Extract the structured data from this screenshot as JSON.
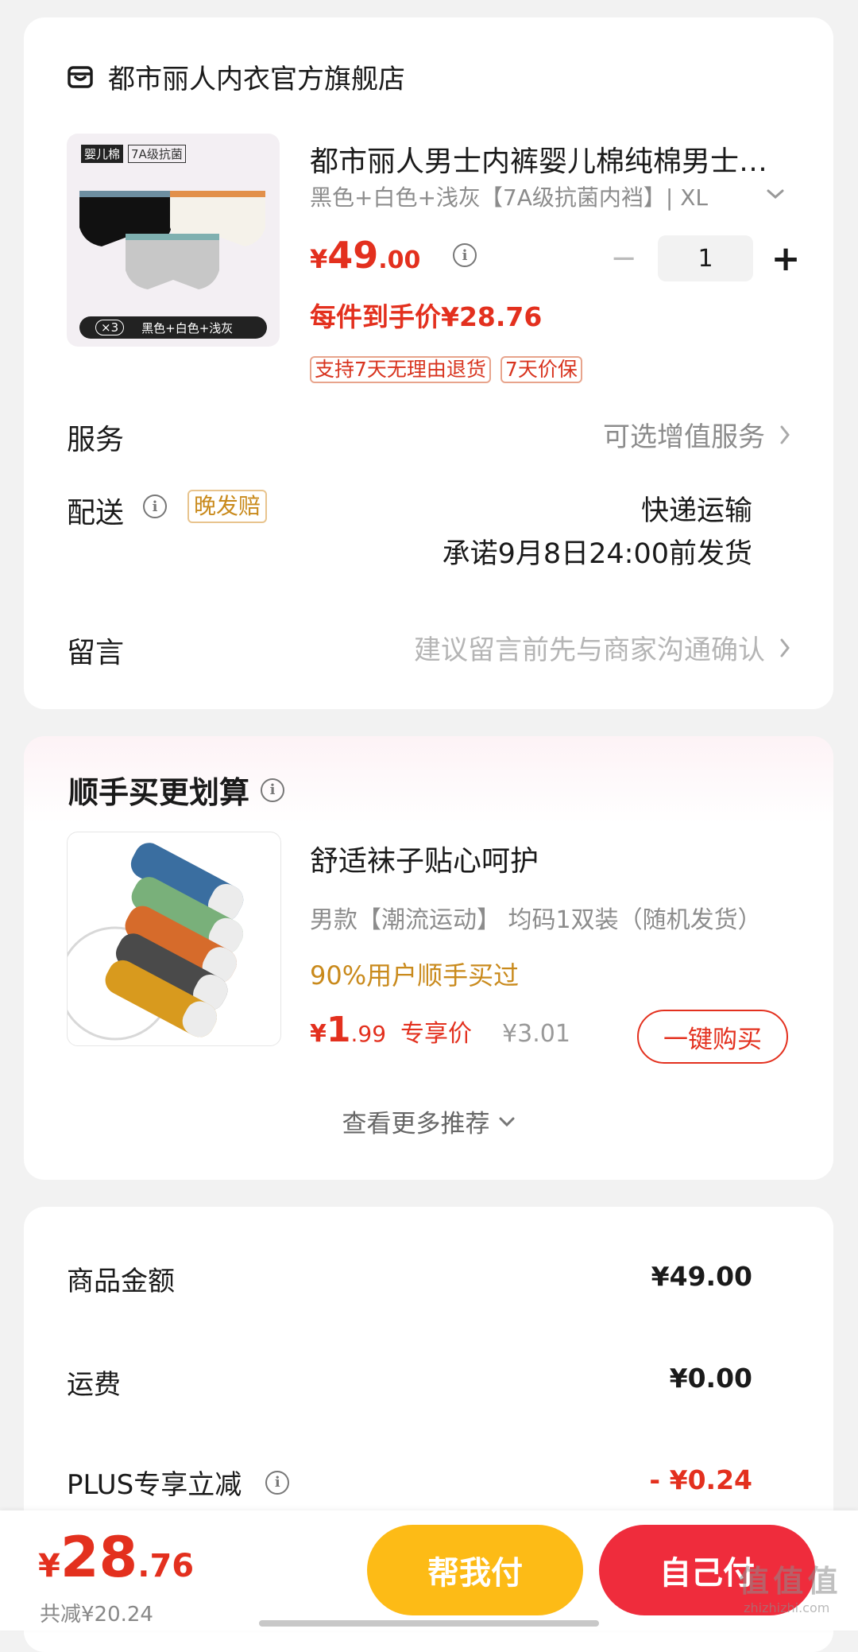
{
  "store": {
    "name": "都市丽人内衣官方旗舰店"
  },
  "product": {
    "thumb_labels": {
      "tag1": "婴儿棉",
      "tag2": "7A级抗菌",
      "count": "×3",
      "colors": "黑色+白色+浅灰"
    },
    "title": "都市丽人男士内裤婴儿棉纯棉男士内裤",
    "variant": "黑色+白色+浅灰【7A级抗菌内裆】| XL",
    "price_symbol": "¥",
    "price_int": "49",
    "price_dec": ".00",
    "per_item_price": "每件到手价¥28.76",
    "quantity": "1",
    "minus": "−",
    "plus": "+",
    "tags": [
      "支持7天无理由退货",
      "7天价保"
    ]
  },
  "service": {
    "label": "服务",
    "value": "可选增值服务"
  },
  "delivery": {
    "label": "配送",
    "badge": "晚发赔",
    "method": "快递运输",
    "promise": "承诺9月8日24:00前发货"
  },
  "message": {
    "label": "留言",
    "placeholder": "建议留言前先与商家沟通确认"
  },
  "recommend": {
    "title": "顺手买更划算",
    "item": {
      "title": "舒适袜子贴心呵护",
      "variant": "男款【潮流运动】  均码1双装（随机发货）",
      "social": "90%用户顺手买过",
      "price_symbol": "¥",
      "price_int": "1",
      "price_dec": ".99",
      "price_label": "专享价",
      "original_price": "¥3.01",
      "buy_button": "一键购买"
    },
    "more": "查看更多推荐"
  },
  "summary": {
    "rows": [
      {
        "label": "商品金额",
        "value": "¥49.00"
      },
      {
        "label": "运费",
        "value": "¥0.00"
      },
      {
        "label": "PLUS专享立减",
        "value": "- ¥0.24"
      }
    ]
  },
  "bottom_bar": {
    "total_symbol": "¥",
    "total_int": "28",
    "total_dec": ".76",
    "saved": "共减¥20.24",
    "help_pay": "帮我付",
    "self_pay": "自己付",
    "watermark": "值 值 值",
    "watermark_url": "zhizhizhi.com"
  },
  "colors": {
    "accent": "#e3301e",
    "gold": "#c98a1c",
    "help_btn": "#fdbb16",
    "self_btn": "#ef2c3c"
  },
  "icons": [
    "store-icon",
    "info-icon",
    "chevron-right-icon",
    "chevron-down-icon",
    "minus-icon",
    "plus-icon"
  ]
}
